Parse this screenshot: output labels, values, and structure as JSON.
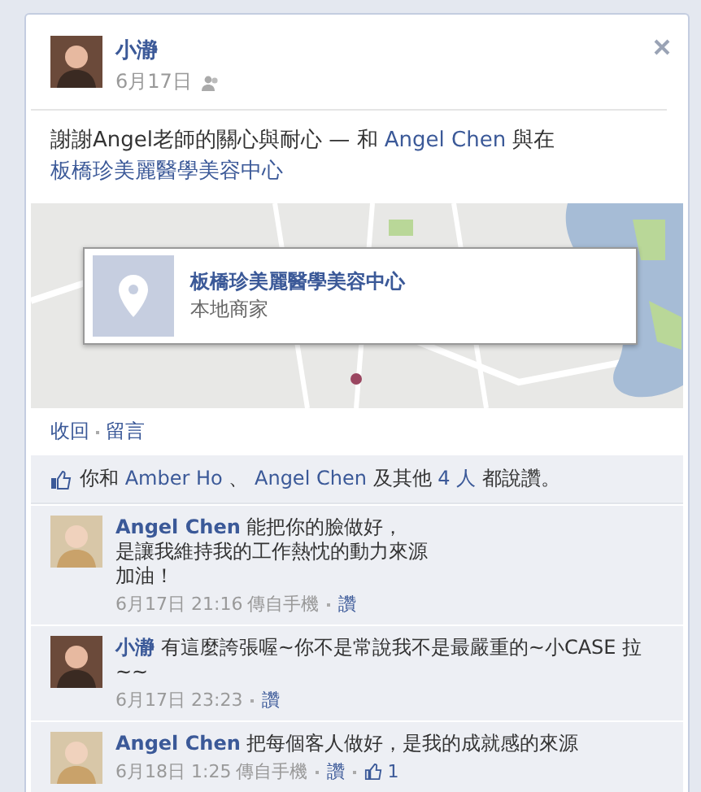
{
  "post": {
    "author": "小瀞",
    "date": "6月17日",
    "body": "謝謝Angel老師的關心與耐心 — 和",
    "tagged": "Angel Chen",
    "joiner": "與",
    "at": "在",
    "place": "板橋珍美麗醫學美容中心"
  },
  "map_card": {
    "title": "板橋珍美麗醫學美容中心",
    "category": "本地商家"
  },
  "actions": [
    "收回",
    "留言"
  ],
  "likes": [
    {
      "kind": "text",
      "text": "你和"
    },
    {
      "kind": "link",
      "text": "Amber Ho"
    },
    {
      "kind": "text",
      "text": "、"
    },
    {
      "kind": "link",
      "text": "Angel Chen"
    },
    {
      "kind": "text",
      "text": "及其他"
    },
    {
      "kind": "link",
      "text": "4 人"
    },
    {
      "kind": "text",
      "text": "都說讚。"
    }
  ],
  "comments": [
    {
      "author": "Angel Chen",
      "lines": [
        "能把你的臉做好，",
        "是讓我維持我的工作熱忱的動力來源",
        "加油！"
      ],
      "time": "6月17日 21:16",
      "source": "傳自手機",
      "like": "讚"
    },
    {
      "author": "小瀞",
      "lines": [
        "有這麼誇張喔~你不是常說我不是最嚴重的~小CASE 拉~~"
      ],
      "time": "6月17日 23:23",
      "like": "讚"
    },
    {
      "author": "Angel Chen",
      "lines": [
        "把每個客人做好，是我的成就感的來源"
      ],
      "time": "6月18日 1:25",
      "source": "傳自手機",
      "like": "讚",
      "like_count": "1"
    }
  ]
}
